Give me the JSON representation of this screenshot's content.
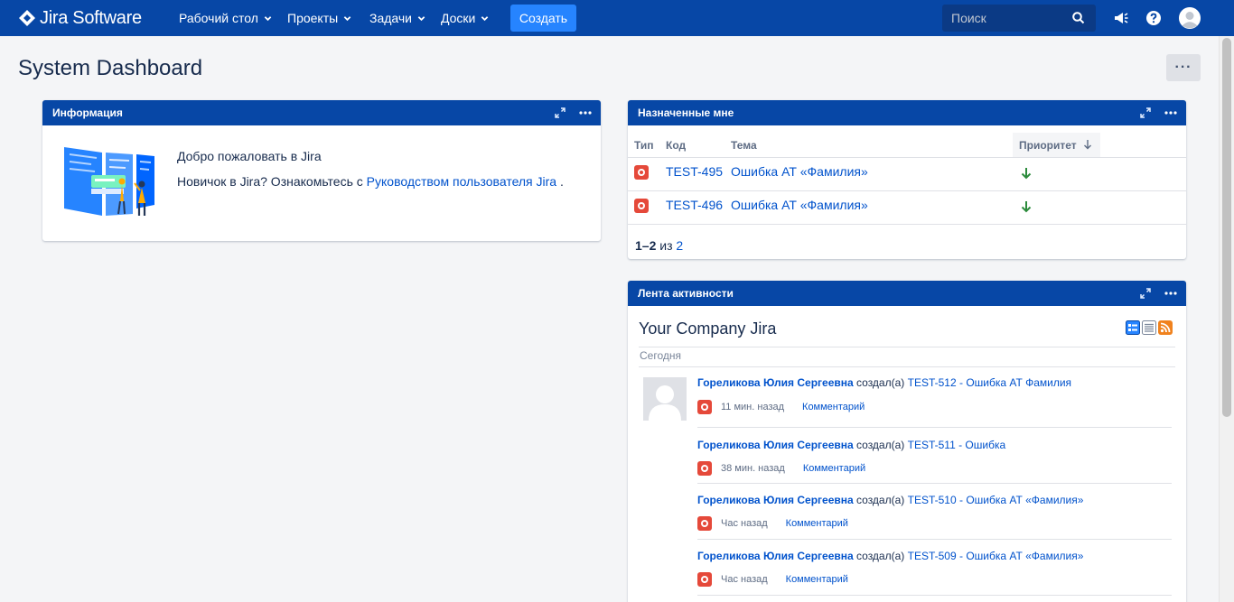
{
  "nav": {
    "logo_text": "Jira Software",
    "dashboards": "Рабочий стол",
    "projects": "Проекты",
    "issues": "Задачи",
    "boards": "Доски",
    "create": "Создать",
    "search_placeholder": "Поиск",
    "brand_color": "#0747a6"
  },
  "page": {
    "title": "System Dashboard",
    "more": "···"
  },
  "info_gadget": {
    "title": "Информация",
    "welcome": "Добро пожаловать в Jira",
    "newbie_text": "Новичок в Jira? Ознакомьтесь с",
    "guide_link": "Руководством пользователя Jira",
    "period": "."
  },
  "assigned_gadget": {
    "title": "Назначенные мне",
    "columns": {
      "type": "Тип",
      "key": "Код",
      "summary": "Тема",
      "priority": "Приоритет"
    },
    "rows": [
      {
        "key": "TEST-495",
        "summary": "Ошибка АТ «Фамилия»",
        "priority_icon": "arrow-down-icon"
      },
      {
        "key": "TEST-496",
        "summary": "Ошибка АТ «Фамилия»",
        "priority_icon": "arrow-down-icon"
      }
    ],
    "pager": {
      "range": "1–2",
      "of": "из",
      "total": "2"
    }
  },
  "activity_gadget": {
    "title": "Лента активности",
    "stream_title": "Your Company Jira",
    "today": "Сегодня",
    "entries": [
      {
        "user": "Гореликова Юлия Сергеевна",
        "action": "создал(а)",
        "issue": "TEST-512 - Ошибка АТ Фамилия",
        "ago": "11 мин. назад",
        "comment": "Комментарий"
      },
      {
        "user": "Гореликова Юлия Сергеевна",
        "action": "создал(а)",
        "issue": "TEST-511 - Ошибка",
        "ago": "38 мин. назад",
        "comment": "Комментарий"
      },
      {
        "user": "Гореликова Юлия Сергеевна",
        "action": "создал(а)",
        "issue": "TEST-510 - Ошибка АТ «Фамилия»",
        "ago": "Час назад",
        "comment": "Комментарий"
      },
      {
        "user": "Гореликова Юлия Сергеевна",
        "action": "создал(а)",
        "issue": "TEST-509 - Ошибка АТ «Фамилия»",
        "ago": "Час назад",
        "comment": "Комментарий"
      }
    ]
  }
}
